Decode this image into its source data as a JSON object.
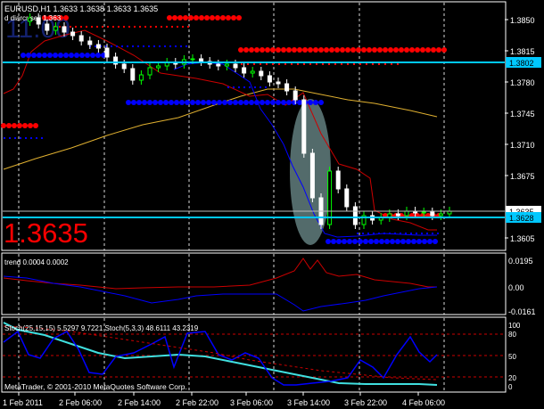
{
  "colors": {
    "background": "#000000",
    "frame": "#ffffff",
    "candle_up": "#00ff00",
    "candle_down": "#ffffff",
    "red_dots": "#ff0000",
    "blue_dots": "#0000ff",
    "hline": "#00c8ff",
    "ma_yellow": "#e0b030",
    "envelope_red": "#cc0000",
    "envelope_blue": "#0000ff",
    "big_price_red": "#ff0000",
    "stoch_cyan": "#40e0e0",
    "stoch_blue": "#0000ff",
    "stoch_red_dash": "#cc0000",
    "grid": "#ffffff"
  },
  "main": {
    "header": "EURUSD,H1  1.3633 1.3638 1.3633 1.3635",
    "sublabel": "d diarcr sell  1.363",
    "ghost_text": "11.00",
    "big_price": "1.3635",
    "price_ticks": [
      "1.3850",
      "1.3815",
      "1.3780",
      "1.3745",
      "1.3710",
      "1.3675",
      "1.3640",
      "1.3605"
    ],
    "price_tags": [
      {
        "label": "1.3802",
        "value": 1.3802,
        "kind": "hline"
      },
      {
        "label": "1.3635",
        "value": 1.3635,
        "kind": "last"
      },
      {
        "label": "1.3628",
        "value": 1.3628,
        "kind": "hline"
      }
    ],
    "y_range": [
      1.3592,
      1.3868
    ]
  },
  "trend": {
    "label": "trend 0.0004 0.0002",
    "ticks": [
      "0.0195",
      "0.00",
      "-0.0161"
    ]
  },
  "stoch": {
    "label": "Stoch(25,15,15) 5.5297 9.7221  Stoch(5,3,3) 48.6111 43.2319",
    "ticks": [
      "100",
      "80",
      "50",
      "20",
      "0"
    ],
    "copyright": "MetaTrader, © 2001-2010 MetaQuotes Software Corp."
  },
  "time_axis": [
    "1 Feb 2011",
    "2 Feb 06:00",
    "2 Feb 14:00",
    "2 Feb 22:00",
    "3 Feb 06:00",
    "3 Feb 14:00",
    "3 Feb 22:00",
    "4 Feb 06:00"
  ],
  "chart_data": {
    "type": "line",
    "symbol": "EURUSD",
    "timeframe": "H1",
    "ohlc_last": {
      "open": 1.3633,
      "high": 1.3638,
      "low": 1.3633,
      "close": 1.3635
    },
    "close_series": [
      1.3848,
      1.3852,
      1.3845,
      1.3838,
      1.3842,
      1.3836,
      1.3832,
      1.3826,
      1.3822,
      1.3818,
      1.3808,
      1.38,
      1.3795,
      1.3782,
      1.3788,
      1.3796,
      1.3798,
      1.3802,
      1.38,
      1.3805,
      1.3806,
      1.3803,
      1.38,
      1.3798,
      1.38,
      1.3796,
      1.379,
      1.3792,
      1.3787,
      1.378,
      1.3778,
      1.377,
      1.376,
      1.37,
      1.365,
      1.362,
      1.368,
      1.366,
      1.364,
      1.362,
      1.363,
      1.3625,
      1.3628,
      1.3632,
      1.363,
      1.3635,
      1.3633,
      1.3634,
      1.363,
      1.3632,
      1.3635
    ],
    "trend_values": {
      "line1": 0.0004,
      "line2": 0.0002
    },
    "stoch_values": {
      "k25": 5.5297,
      "d25": 9.7221,
      "k5": 48.6111,
      "d5": 43.2319
    }
  }
}
